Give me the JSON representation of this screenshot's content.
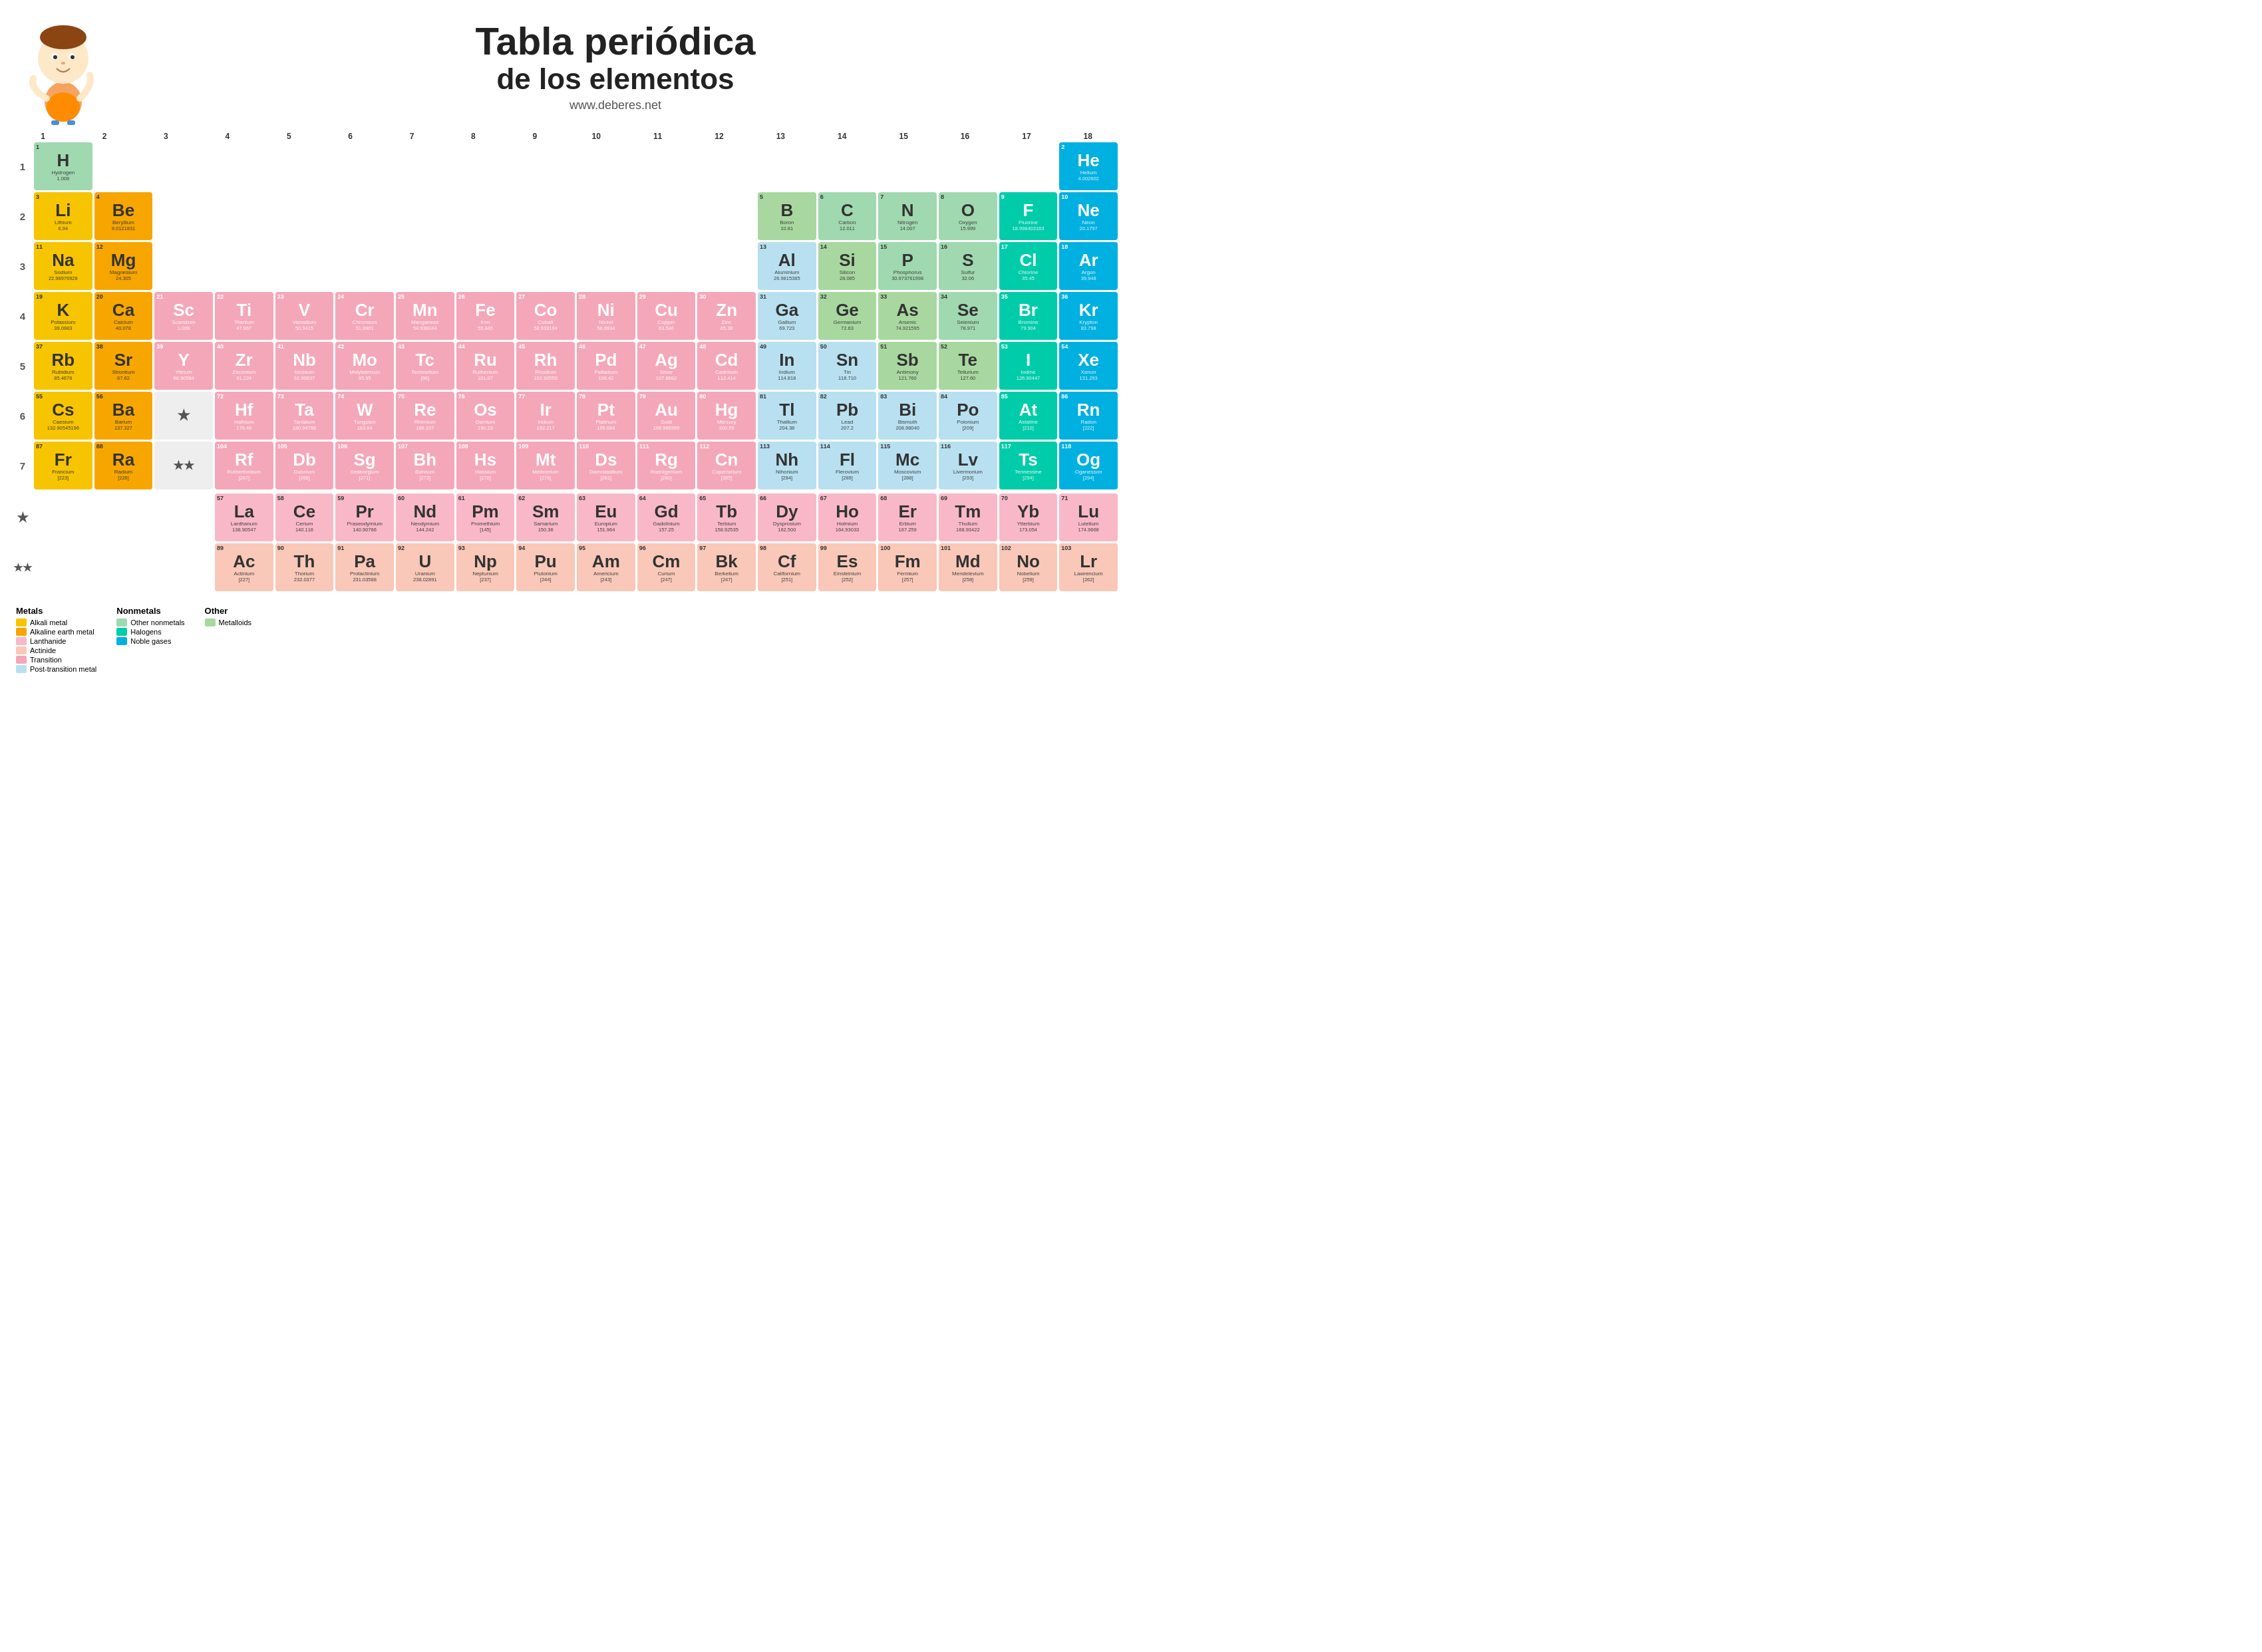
{
  "title": {
    "line1": "Tabla periódica",
    "line2": "de los elementos",
    "url": "www.deberes.net"
  },
  "groupLabels": [
    "1",
    "2",
    "3",
    "4",
    "5",
    "6",
    "7",
    "8",
    "9",
    "10",
    "11",
    "12",
    "13",
    "14",
    "15",
    "16",
    "17",
    "18"
  ],
  "periodLabels": [
    "1",
    "2",
    "3",
    "4",
    "5",
    "6",
    "7"
  ],
  "elements": {
    "H": {
      "num": 1,
      "sym": "H",
      "name": "Hydrogen",
      "mass": "1.008",
      "type": "other-nonmetal",
      "col": 1,
      "row": 1
    },
    "He": {
      "num": 2,
      "sym": "He",
      "name": "Helium",
      "mass": "4.002602",
      "type": "noble",
      "col": 18,
      "row": 1
    },
    "Li": {
      "num": 3,
      "sym": "Li",
      "name": "Lithium",
      "mass": "6.94",
      "type": "alkali",
      "col": 1,
      "row": 2
    },
    "Be": {
      "num": 4,
      "sym": "Be",
      "name": "Beryllium",
      "mass": "9.0121831",
      "type": "alkali-earth",
      "col": 2,
      "row": 2
    },
    "B": {
      "num": 5,
      "sym": "B",
      "name": "Boron",
      "mass": "10.81",
      "type": "metalloid",
      "col": 13,
      "row": 2
    },
    "C": {
      "num": 6,
      "sym": "C",
      "name": "Carbon",
      "mass": "12.011",
      "type": "other-nonmetal",
      "col": 14,
      "row": 2
    },
    "N": {
      "num": 7,
      "sym": "N",
      "name": "Nitrogen",
      "mass": "14.007",
      "type": "other-nonmetal",
      "col": 15,
      "row": 2
    },
    "O": {
      "num": 8,
      "sym": "O",
      "name": "Oxygen",
      "mass": "15.999",
      "type": "other-nonmetal",
      "col": 16,
      "row": 2
    },
    "F": {
      "num": 9,
      "sym": "F",
      "name": "Fluorine",
      "mass": "18.998403163",
      "type": "halogen",
      "col": 17,
      "row": 2
    },
    "Ne": {
      "num": 10,
      "sym": "Ne",
      "name": "Neon",
      "mass": "20.1797",
      "type": "noble",
      "col": 18,
      "row": 2
    },
    "Na": {
      "num": 11,
      "sym": "Na",
      "name": "Sodium",
      "mass": "22.98976928",
      "type": "alkali",
      "col": 1,
      "row": 3
    },
    "Mg": {
      "num": 12,
      "sym": "Mg",
      "name": "Magnesium",
      "mass": "24.305",
      "type": "alkali-earth",
      "col": 2,
      "row": 3
    },
    "Al": {
      "num": 13,
      "sym": "Al",
      "name": "Aluminium",
      "mass": "26.9815385",
      "type": "post-transition",
      "col": 13,
      "row": 3
    },
    "Si": {
      "num": 14,
      "sym": "Si",
      "name": "Silicon",
      "mass": "28.085",
      "type": "metalloid",
      "col": 14,
      "row": 3
    },
    "P": {
      "num": 15,
      "sym": "P",
      "name": "Phosphorus",
      "mass": "30.973761998",
      "type": "other-nonmetal",
      "col": 15,
      "row": 3
    },
    "S": {
      "num": 16,
      "sym": "S",
      "name": "Sulfur",
      "mass": "32.06",
      "type": "other-nonmetal",
      "col": 16,
      "row": 3
    },
    "Cl": {
      "num": 17,
      "sym": "Cl",
      "name": "Chlorine",
      "mass": "35.45",
      "type": "halogen",
      "col": 17,
      "row": 3
    },
    "Ar": {
      "num": 18,
      "sym": "Ar",
      "name": "Argon",
      "mass": "39.948",
      "type": "noble",
      "col": 18,
      "row": 3
    },
    "K": {
      "num": 19,
      "sym": "K",
      "name": "Potassium",
      "mass": "39.0983",
      "type": "alkali",
      "col": 1,
      "row": 4
    },
    "Ca": {
      "num": 20,
      "sym": "Ca",
      "name": "Calcium",
      "mass": "40.078",
      "type": "alkali-earth",
      "col": 2,
      "row": 4
    },
    "Sc": {
      "num": 21,
      "sym": "Sc",
      "name": "Scandium",
      "mass": "1.008",
      "type": "transition",
      "col": 3,
      "row": 4
    },
    "Ti": {
      "num": 22,
      "sym": "Ti",
      "name": "Titanium",
      "mass": "47.867",
      "type": "transition",
      "col": 4,
      "row": 4
    },
    "V": {
      "num": 23,
      "sym": "V",
      "name": "Vanadium",
      "mass": "50.9415",
      "type": "transition",
      "col": 5,
      "row": 4
    },
    "Cr": {
      "num": 24,
      "sym": "Cr",
      "name": "Chromium",
      "mass": "51.9961",
      "type": "transition",
      "col": 6,
      "row": 4
    },
    "Mn": {
      "num": 25,
      "sym": "Mn",
      "name": "Manganese",
      "mass": "54.938044",
      "type": "transition",
      "col": 7,
      "row": 4
    },
    "Fe": {
      "num": 26,
      "sym": "Fe",
      "name": "Iron",
      "mass": "55.845",
      "type": "transition",
      "col": 8,
      "row": 4
    },
    "Co": {
      "num": 27,
      "sym": "Co",
      "name": "Cobalt",
      "mass": "58.933194",
      "type": "transition",
      "col": 9,
      "row": 4
    },
    "Ni": {
      "num": 28,
      "sym": "Ni",
      "name": "Nickel",
      "mass": "58.6934",
      "type": "transition",
      "col": 10,
      "row": 4
    },
    "Cu": {
      "num": 29,
      "sym": "Cu",
      "name": "Copper",
      "mass": "63.546",
      "type": "transition",
      "col": 11,
      "row": 4
    },
    "Zn": {
      "num": 30,
      "sym": "Zn",
      "name": "Zinc",
      "mass": "65.38",
      "type": "transition",
      "col": 12,
      "row": 4
    },
    "Ga": {
      "num": 31,
      "sym": "Ga",
      "name": "Gallium",
      "mass": "69.723",
      "type": "post-transition",
      "col": 13,
      "row": 4
    },
    "Ge": {
      "num": 32,
      "sym": "Ge",
      "name": "Germanium",
      "mass": "72.63",
      "type": "metalloid",
      "col": 14,
      "row": 4
    },
    "As": {
      "num": 33,
      "sym": "As",
      "name": "Arsenic",
      "mass": "74.921595",
      "type": "metalloid",
      "col": 15,
      "row": 4
    },
    "Se": {
      "num": 34,
      "sym": "Se",
      "name": "Selenium",
      "mass": "78.971",
      "type": "other-nonmetal",
      "col": 16,
      "row": 4
    },
    "Br": {
      "num": 35,
      "sym": "Br",
      "name": "Bromine",
      "mass": "79.904",
      "type": "halogen",
      "col": 17,
      "row": 4
    },
    "Kr": {
      "num": 36,
      "sym": "Kr",
      "name": "Krypton",
      "mass": "83.798",
      "type": "noble",
      "col": 18,
      "row": 4
    },
    "Rb": {
      "num": 37,
      "sym": "Rb",
      "name": "Rubidium",
      "mass": "85.4678",
      "type": "alkali",
      "col": 1,
      "row": 5
    },
    "Sr": {
      "num": 38,
      "sym": "Sr",
      "name": "Strontium",
      "mass": "87.62",
      "type": "alkali-earth",
      "col": 2,
      "row": 5
    },
    "Y": {
      "num": 39,
      "sym": "Y",
      "name": "Yttrium",
      "mass": "88.90584",
      "type": "transition",
      "col": 3,
      "row": 5
    },
    "Zr": {
      "num": 40,
      "sym": "Zr",
      "name": "Zirconium",
      "mass": "91.224",
      "type": "transition",
      "col": 4,
      "row": 5
    },
    "Nb": {
      "num": 41,
      "sym": "Nb",
      "name": "Niobium",
      "mass": "92.90637",
      "type": "transition",
      "col": 5,
      "row": 5
    },
    "Mo": {
      "num": 42,
      "sym": "Mo",
      "name": "Molybdenum",
      "mass": "95.95",
      "type": "transition",
      "col": 6,
      "row": 5
    },
    "Tc": {
      "num": 43,
      "sym": "Tc",
      "name": "Technetium",
      "mass": "[98]",
      "type": "transition",
      "col": 7,
      "row": 5
    },
    "Ru": {
      "num": 44,
      "sym": "Ru",
      "name": "Ruthenium",
      "mass": "101.07",
      "type": "transition",
      "col": 8,
      "row": 5
    },
    "Rh": {
      "num": 45,
      "sym": "Rh",
      "name": "Rhodium",
      "mass": "102.90550",
      "type": "transition",
      "col": 9,
      "row": 5
    },
    "Pd": {
      "num": 46,
      "sym": "Pd",
      "name": "Palladium",
      "mass": "106.42",
      "type": "transition",
      "col": 10,
      "row": 5
    },
    "Ag": {
      "num": 47,
      "sym": "Ag",
      "name": "Silver",
      "mass": "107.8682",
      "type": "transition",
      "col": 11,
      "row": 5
    },
    "Cd": {
      "num": 48,
      "sym": "Cd",
      "name": "Cadmium",
      "mass": "112.414",
      "type": "transition",
      "col": 12,
      "row": 5
    },
    "In": {
      "num": 49,
      "sym": "In",
      "name": "Indium",
      "mass": "114.818",
      "type": "post-transition",
      "col": 13,
      "row": 5
    },
    "Sn": {
      "num": 50,
      "sym": "Sn",
      "name": "Tin",
      "mass": "118.710",
      "type": "post-transition",
      "col": 14,
      "row": 5
    },
    "Sb": {
      "num": 51,
      "sym": "Sb",
      "name": "Antimony",
      "mass": "121.760",
      "type": "metalloid",
      "col": 15,
      "row": 5
    },
    "Te": {
      "num": 52,
      "sym": "Te",
      "name": "Tellurium",
      "mass": "127.60",
      "type": "metalloid",
      "col": 16,
      "row": 5
    },
    "I": {
      "num": 53,
      "sym": "I",
      "name": "Iodine",
      "mass": "126.90447",
      "type": "halogen",
      "col": 17,
      "row": 5
    },
    "Xe": {
      "num": 54,
      "sym": "Xe",
      "name": "Xenon",
      "mass": "131.293",
      "type": "noble",
      "col": 18,
      "row": 5
    },
    "Cs": {
      "num": 55,
      "sym": "Cs",
      "name": "Caesium",
      "mass": "132.90545196",
      "type": "alkali",
      "col": 1,
      "row": 6
    },
    "Ba": {
      "num": 56,
      "sym": "Ba",
      "name": "Barium",
      "mass": "137.327",
      "type": "alkali-earth",
      "col": 2,
      "row": 6
    },
    "Hf": {
      "num": 72,
      "sym": "Hf",
      "name": "Hafnium",
      "mass": "178.49",
      "type": "transition",
      "col": 4,
      "row": 6
    },
    "Ta": {
      "num": 73,
      "sym": "Ta",
      "name": "Tantalum",
      "mass": "180.94788",
      "type": "transition",
      "col": 5,
      "row": 6
    },
    "W": {
      "num": 74,
      "sym": "W",
      "name": "Tungsten",
      "mass": "183.84",
      "type": "transition",
      "col": 6,
      "row": 6
    },
    "Re": {
      "num": 75,
      "sym": "Re",
      "name": "Rhenium",
      "mass": "186.207",
      "type": "transition",
      "col": 7,
      "row": 6
    },
    "Os": {
      "num": 76,
      "sym": "Os",
      "name": "Osmium",
      "mass": "190.23",
      "type": "transition",
      "col": 8,
      "row": 6
    },
    "Ir": {
      "num": 77,
      "sym": "Ir",
      "name": "Iridium",
      "mass": "192.217",
      "type": "transition",
      "col": 9,
      "row": 6
    },
    "Pt": {
      "num": 78,
      "sym": "Pt",
      "name": "Platinum",
      "mass": "195.084",
      "type": "transition",
      "col": 10,
      "row": 6
    },
    "Au": {
      "num": 79,
      "sym": "Au",
      "name": "Gold",
      "mass": "196.966569",
      "type": "transition",
      "col": 11,
      "row": 6
    },
    "Hg": {
      "num": 80,
      "sym": "Hg",
      "name": "Mercury",
      "mass": "200.59",
      "type": "transition",
      "col": 12,
      "row": 6
    },
    "Tl": {
      "num": 81,
      "sym": "Tl",
      "name": "Thallium",
      "mass": "204.38",
      "type": "post-transition",
      "col": 13,
      "row": 6
    },
    "Pb": {
      "num": 82,
      "sym": "Pb",
      "name": "Lead",
      "mass": "207.2",
      "type": "post-transition",
      "col": 14,
      "row": 6
    },
    "Bi": {
      "num": 83,
      "sym": "Bi",
      "name": "Bismuth",
      "mass": "208.98040",
      "type": "post-transition",
      "col": 15,
      "row": 6
    },
    "Po": {
      "num": 84,
      "sym": "Po",
      "name": "Polonium",
      "mass": "[209]",
      "type": "post-transition",
      "col": 16,
      "row": 6
    },
    "At": {
      "num": 85,
      "sym": "At",
      "name": "Astatine",
      "mass": "[210]",
      "type": "halogen",
      "col": 17,
      "row": 6
    },
    "Rn": {
      "num": 86,
      "sym": "Rn",
      "name": "Radon",
      "mass": "[222]",
      "type": "noble",
      "col": 18,
      "row": 6
    },
    "Fr": {
      "num": 87,
      "sym": "Fr",
      "name": "Francium",
      "mass": "[223]",
      "type": "alkali",
      "col": 1,
      "row": 7
    },
    "Ra": {
      "num": 88,
      "sym": "Ra",
      "name": "Radium",
      "mass": "[226]",
      "type": "alkali-earth",
      "col": 2,
      "row": 7
    },
    "Rf": {
      "num": 104,
      "sym": "Rf",
      "name": "Rutherfordium",
      "mass": "[267]",
      "type": "transition",
      "col": 4,
      "row": 7
    },
    "Db": {
      "num": 105,
      "sym": "Db",
      "name": "Dubnium",
      "mass": "[268]",
      "type": "transition",
      "col": 5,
      "row": 7
    },
    "Sg": {
      "num": 106,
      "sym": "Sg",
      "name": "Seaborgium",
      "mass": "[271]",
      "type": "transition",
      "col": 6,
      "row": 7
    },
    "Bh": {
      "num": 107,
      "sym": "Bh",
      "name": "Bohrium",
      "mass": "[272]",
      "type": "transition",
      "col": 7,
      "row": 7
    },
    "Hs": {
      "num": 108,
      "sym": "Hs",
      "name": "Hassium",
      "mass": "[270]",
      "type": "transition",
      "col": 8,
      "row": 7
    },
    "Mt": {
      "num": 109,
      "sym": "Mt",
      "name": "Meitnerium",
      "mass": "[276]",
      "type": "transition",
      "col": 9,
      "row": 7
    },
    "Ds": {
      "num": 110,
      "sym": "Ds",
      "name": "Darmstadtium",
      "mass": "[281]",
      "type": "transition",
      "col": 10,
      "row": 7
    },
    "Rg": {
      "num": 111,
      "sym": "Rg",
      "name": "Roentgenium",
      "mass": "[280]",
      "type": "transition",
      "col": 11,
      "row": 7
    },
    "Cn": {
      "num": 112,
      "sym": "Cn",
      "name": "Copernicium",
      "mass": "[285]",
      "type": "transition",
      "col": 12,
      "row": 7
    },
    "Nh": {
      "num": 113,
      "sym": "Nh",
      "name": "Nihonium",
      "mass": "[284]",
      "type": "post-transition",
      "col": 13,
      "row": 7
    },
    "Fl": {
      "num": 114,
      "sym": "Fl",
      "name": "Flerovium",
      "mass": "[289]",
      "type": "post-transition",
      "col": 14,
      "row": 7
    },
    "Mc": {
      "num": 115,
      "sym": "Mc",
      "name": "Moscovium",
      "mass": "[288]",
      "type": "post-transition",
      "col": 15,
      "row": 7
    },
    "Lv": {
      "num": 116,
      "sym": "Lv",
      "name": "Livermorium",
      "mass": "[293]",
      "type": "post-transition",
      "col": 16,
      "row": 7
    },
    "Ts": {
      "num": 117,
      "sym": "Ts",
      "name": "Tennessine",
      "mass": "[294]",
      "type": "halogen",
      "col": 17,
      "row": 7
    },
    "Og": {
      "num": 118,
      "sym": "Og",
      "name": "Oganesson",
      "mass": "[294]",
      "type": "noble",
      "col": 18,
      "row": 7
    }
  },
  "lanthanides": [
    {
      "num": 57,
      "sym": "La",
      "name": "Lanthanum",
      "mass": "138.90547"
    },
    {
      "num": 58,
      "sym": "Ce",
      "name": "Cerium",
      "mass": "140.116"
    },
    {
      "num": 59,
      "sym": "Pr",
      "name": "Praseodymium",
      "mass": "140.90766"
    },
    {
      "num": 60,
      "sym": "Nd",
      "name": "Neodymium",
      "mass": "144.242"
    },
    {
      "num": 61,
      "sym": "Pm",
      "name": "Promethium",
      "mass": "[145]"
    },
    {
      "num": 62,
      "sym": "Sm",
      "name": "Samarium",
      "mass": "150.36"
    },
    {
      "num": 63,
      "sym": "Eu",
      "name": "Europium",
      "mass": "151.964"
    },
    {
      "num": 64,
      "sym": "Gd",
      "name": "Gadolinium",
      "mass": "157.25"
    },
    {
      "num": 65,
      "sym": "Tb",
      "name": "Terbium",
      "mass": "158.92535"
    },
    {
      "num": 66,
      "sym": "Dy",
      "name": "Dysprosium",
      "mass": "162.500"
    },
    {
      "num": 67,
      "sym": "Ho",
      "name": "Holmium",
      "mass": "164.93033"
    },
    {
      "num": 68,
      "sym": "Er",
      "name": "Erbium",
      "mass": "167.259"
    },
    {
      "num": 69,
      "sym": "Tm",
      "name": "Thulium",
      "mass": "168.93422"
    },
    {
      "num": 70,
      "sym": "Yb",
      "name": "Ytterbium",
      "mass": "173.054"
    },
    {
      "num": 71,
      "sym": "Lu",
      "name": "Lutetium",
      "mass": "174.9668"
    }
  ],
  "actinides": [
    {
      "num": 89,
      "sym": "Ac",
      "name": "Actinium",
      "mass": "[227]"
    },
    {
      "num": 90,
      "sym": "Th",
      "name": "Thorium",
      "mass": "232.0377"
    },
    {
      "num": 91,
      "sym": "Pa",
      "name": "Protactinium",
      "mass": "231.03588"
    },
    {
      "num": 92,
      "sym": "U",
      "name": "Uranium",
      "mass": "238.02891"
    },
    {
      "num": 93,
      "sym": "Np",
      "name": "Neptunium",
      "mass": "[237]"
    },
    {
      "num": 94,
      "sym": "Pu",
      "name": "Plutonium",
      "mass": "[244]"
    },
    {
      "num": 95,
      "sym": "Am",
      "name": "Americium",
      "mass": "[243]"
    },
    {
      "num": 96,
      "sym": "Cm",
      "name": "Curium",
      "mass": "[247]"
    },
    {
      "num": 97,
      "sym": "Bk",
      "name": "Berkelium",
      "mass": "[247]"
    },
    {
      "num": 98,
      "sym": "Cf",
      "name": "Californium",
      "mass": "[251]"
    },
    {
      "num": 99,
      "sym": "Es",
      "name": "Einsteinium",
      "mass": "[252]"
    },
    {
      "num": 100,
      "sym": "Fm",
      "name": "Fermium",
      "mass": "[257]"
    },
    {
      "num": 101,
      "sym": "Md",
      "name": "Mendelevium",
      "mass": "[258]"
    },
    {
      "num": 102,
      "sym": "No",
      "name": "Nobelium",
      "mass": "[259]"
    },
    {
      "num": 103,
      "sym": "Lr",
      "name": "Lawrencium",
      "mass": "[262]"
    }
  ],
  "legend": {
    "metals_title": "Metals",
    "items_metals": [
      {
        "label": "Alkali metal",
        "color": "#f7c400"
      },
      {
        "label": "Alkaline earth metal",
        "color": "#f7a600"
      },
      {
        "label": "Lanthanide",
        "color": "#f9b8c8"
      },
      {
        "label": "Actinide",
        "color": "#f9c8b8"
      },
      {
        "label": "Transition",
        "color": "#f4a7b9"
      },
      {
        "label": "Post-transition metal",
        "color": "#b8e0f0"
      }
    ],
    "nonmetals_title": "Nonmetals",
    "items_nonmetals": [
      {
        "label": "Other nonmetals",
        "color": "#a0d8b0"
      },
      {
        "label": "Halogens",
        "color": "#00ccaa"
      },
      {
        "label": "Noble gases",
        "color": "#00b0e0"
      }
    ],
    "other_title": "Other",
    "items_other": [
      {
        "label": "Metalloids",
        "color": "#a8d8a0"
      }
    ]
  }
}
